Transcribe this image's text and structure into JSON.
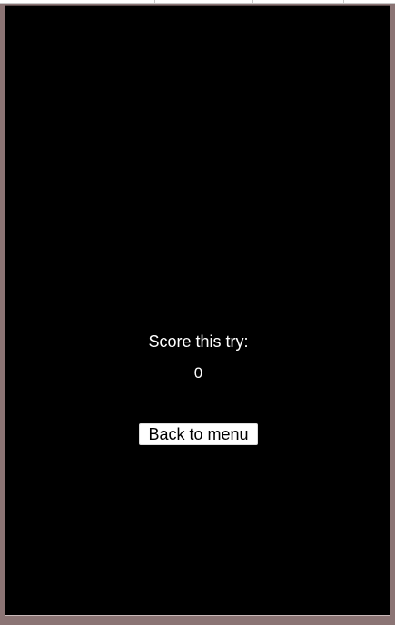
{
  "result": {
    "score_label": "Score this try:",
    "score_value": "0"
  },
  "actions": {
    "back_label": "Back to menu"
  },
  "colors": {
    "frame": "#8b7474",
    "background": "#000000",
    "text": "#ffffff",
    "button_bg": "#ffffff",
    "button_text": "#000000"
  }
}
